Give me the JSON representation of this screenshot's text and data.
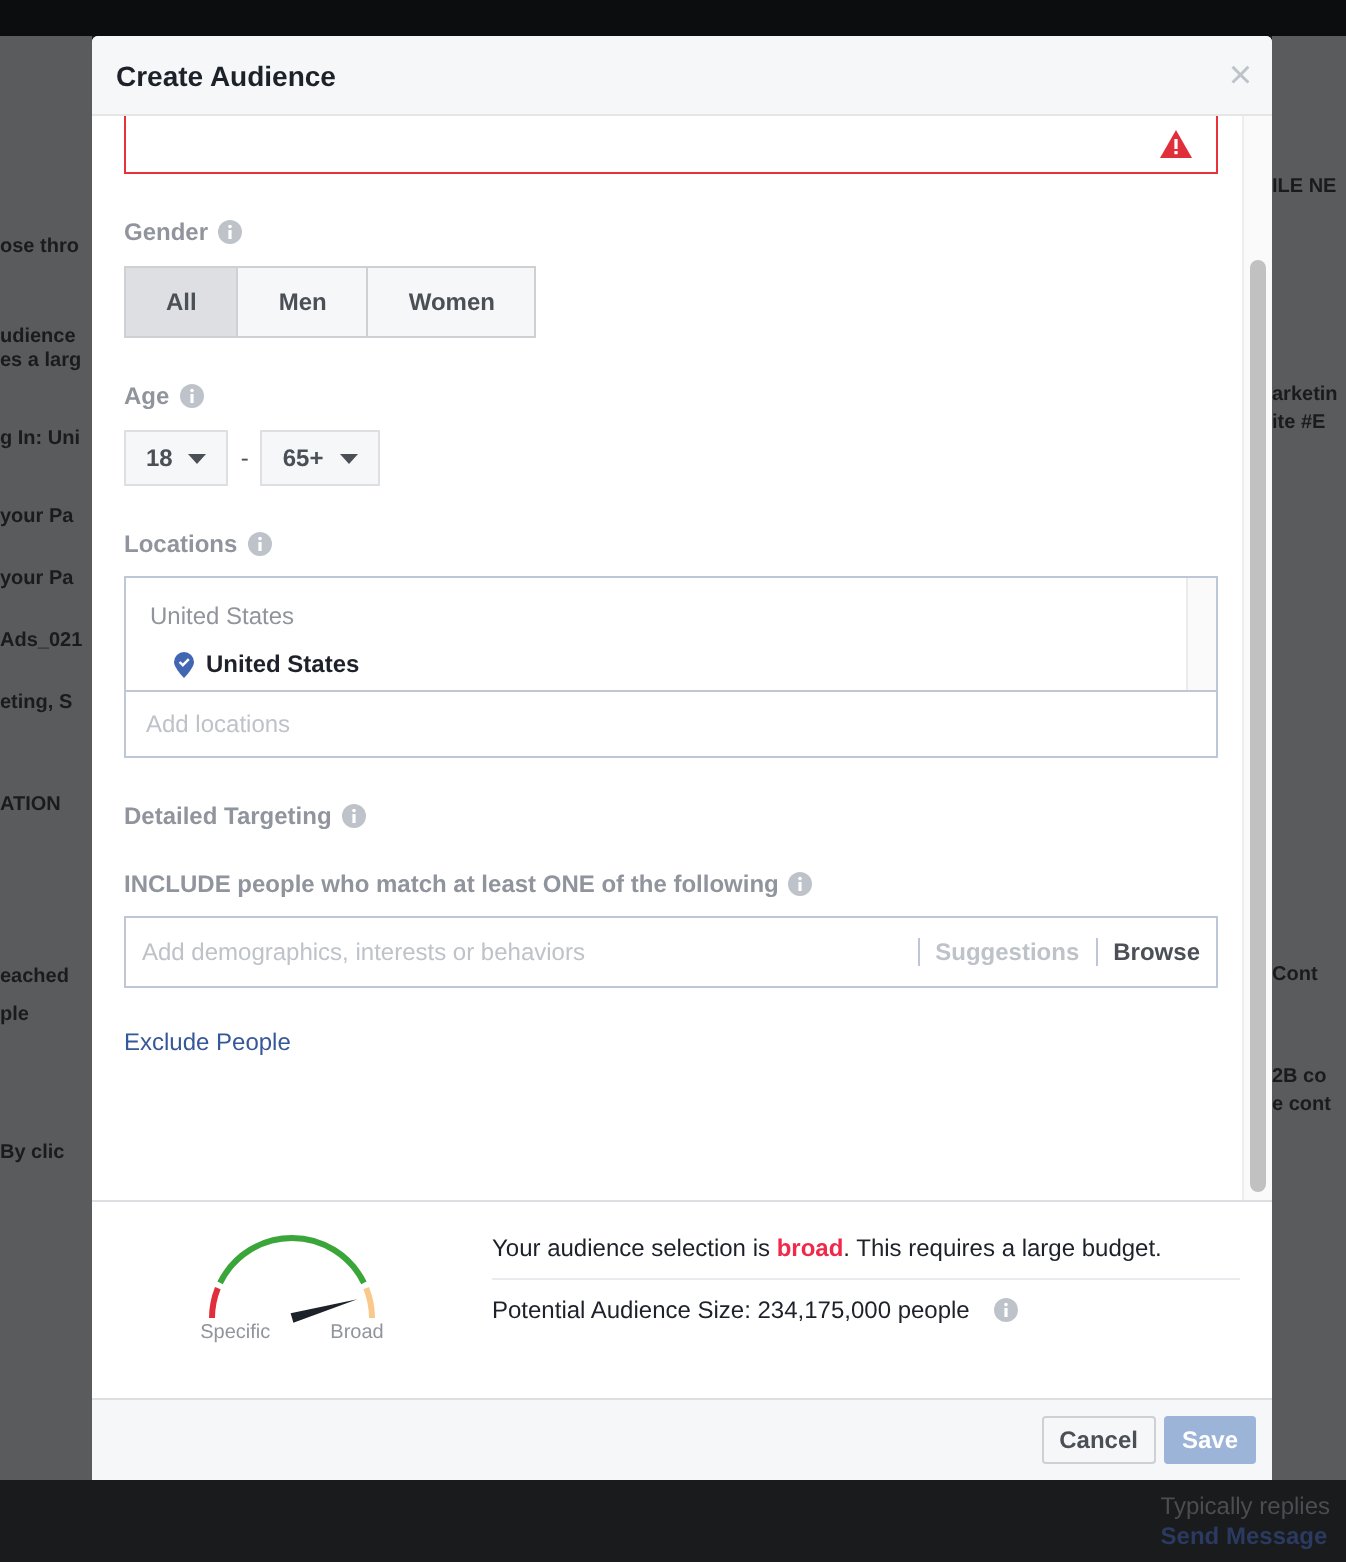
{
  "background": {
    "left_texts": [
      "ose thro",
      "udience",
      "es a larg",
      "g In: Uni",
      "your Pa",
      "your Pa",
      "Ads_021",
      "eting, S",
      "ATION",
      "eached",
      "ple",
      "By clic"
    ],
    "right_texts": [
      "ILE NE",
      "arketin",
      "ite #E",
      "Cont",
      "2B co",
      "e cont"
    ],
    "messenger": {
      "line_1": "Typically replies",
      "line_2": "Send Message"
    }
  },
  "dialog": {
    "title": "Create Audience",
    "close": "×",
    "gender": {
      "label": "Gender",
      "options": [
        {
          "label": "All",
          "selected": true
        },
        {
          "label": "Men",
          "selected": false
        },
        {
          "label": "Women",
          "selected": false
        }
      ]
    },
    "age": {
      "label": "Age",
      "min": "18",
      "separator": "-",
      "max": "65+"
    },
    "locations": {
      "label": "Locations",
      "group": "United States",
      "items": [
        "United States"
      ],
      "placeholder": "Add locations"
    },
    "detailed_targeting": {
      "label": "Detailed Targeting",
      "include_label": "INCLUDE people who match at least ONE of the following",
      "placeholder": "Add demographics, interests or behaviors",
      "suggestions": "Suggestions",
      "browse": "Browse"
    },
    "exclude_link": "Exclude People",
    "audience": {
      "gauge": {
        "min_label": "Specific",
        "max_label": "Broad"
      },
      "message": "Your audience selection is **broad**. This requires a large budget.",
      "size": "Potential Audience Size: 234,175,000 people"
    },
    "buttons": [
      {
        "label": "Cancel",
        "kind": "secondary"
      },
      {
        "label": "Save",
        "kind": "primary",
        "disabled": true
      }
    ]
  }
}
